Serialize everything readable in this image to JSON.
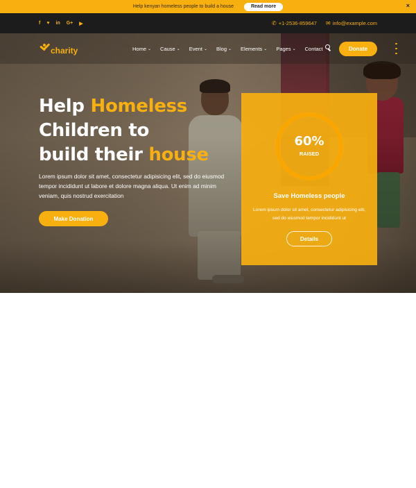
{
  "announcement": {
    "text": "Help kenyan homeless people to build a house",
    "button_label": "Read more",
    "close_glyph": "×"
  },
  "topbar": {
    "social_icons": [
      {
        "name": "facebook-icon",
        "glyph": "f"
      },
      {
        "name": "twitter-icon",
        "glyph": "♥"
      },
      {
        "name": "linkedin-icon",
        "glyph": "in"
      },
      {
        "name": "googleplus-icon",
        "glyph": "G+"
      },
      {
        "name": "youtube-icon",
        "glyph": "▶"
      }
    ],
    "phone": "+1-2536-859647",
    "email": "info@example.com"
  },
  "nav": {
    "logo_text": "charity",
    "items": [
      {
        "label": "Home",
        "has_dropdown": true
      },
      {
        "label": "Cause",
        "has_dropdown": true
      },
      {
        "label": "Event",
        "has_dropdown": true
      },
      {
        "label": "Blog",
        "has_dropdown": true
      },
      {
        "label": "Elements",
        "has_dropdown": true
      },
      {
        "label": "Pages",
        "has_dropdown": true
      },
      {
        "label": "Contact",
        "has_dropdown": false
      }
    ],
    "donate_label": "Donate"
  },
  "hero": {
    "headline_1": "Help ",
    "headline_1_accent": "Homeless",
    "headline_2": "Children to",
    "headline_3": "build their ",
    "headline_3_accent": "house",
    "description": "Lorem ipsum dolor sit amet, consectetur adipisicing elit, sed do eiusmod tempor incididunt ut labore et dolore magna aliqua. Ut enim ad minim veniam, quis nostrud exercitation",
    "button_label": "Make Donation"
  },
  "cause_card": {
    "progress_percent": 60,
    "progress_text": "60%",
    "progress_label": "RAISED",
    "title": "Save Homeless people",
    "description": "Lorem ipsum dolor sit amet, consectetur adipisicing elit, sed do eiusmod tempor incididunt ut",
    "button_label": "Details"
  },
  "colors": {
    "accent": "#f7b010",
    "topbar_bg": "#1c1c1c",
    "text_light": "#ffffff"
  }
}
